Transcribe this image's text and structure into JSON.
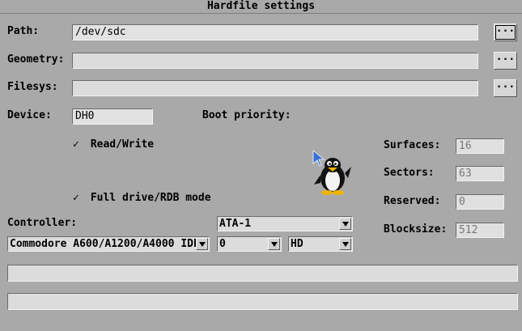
{
  "window": {
    "title": "Hardfile settings"
  },
  "path": {
    "label": "Path:",
    "value": "/dev/sdc",
    "button": "..."
  },
  "geometry": {
    "label": "Geometry:",
    "value": "",
    "button": "..."
  },
  "filesys": {
    "label": "Filesys:",
    "value": "",
    "button": "..."
  },
  "device": {
    "label": "Device:",
    "value": "DH0"
  },
  "boot_priority": {
    "label": "Boot priority:"
  },
  "read_write": {
    "label": "Read/Write",
    "checked": true,
    "mark": "✓"
  },
  "full_drive": {
    "label": "Full drive/RDB mode",
    "checked": true,
    "mark": "✓"
  },
  "geometry_fields": {
    "surfaces": {
      "label": "Surfaces:",
      "value": "16"
    },
    "sectors": {
      "label": "Sectors:",
      "value": "63"
    },
    "reserved": {
      "label": "Reserved:",
      "value": "0"
    },
    "blocksize": {
      "label": "Blocksize:",
      "value": "512"
    }
  },
  "controller": {
    "label": "Controller:",
    "type": "ATA-1",
    "model": "Commodore A600/A1200/A4000 IDE",
    "unit": "0",
    "media": "HD"
  },
  "icons": {
    "mascot": "penguin-icon",
    "pointer": "mouse-pointer-icon"
  },
  "colors": {
    "background": "#a9a9a9",
    "field": "#dcdcdc"
  }
}
